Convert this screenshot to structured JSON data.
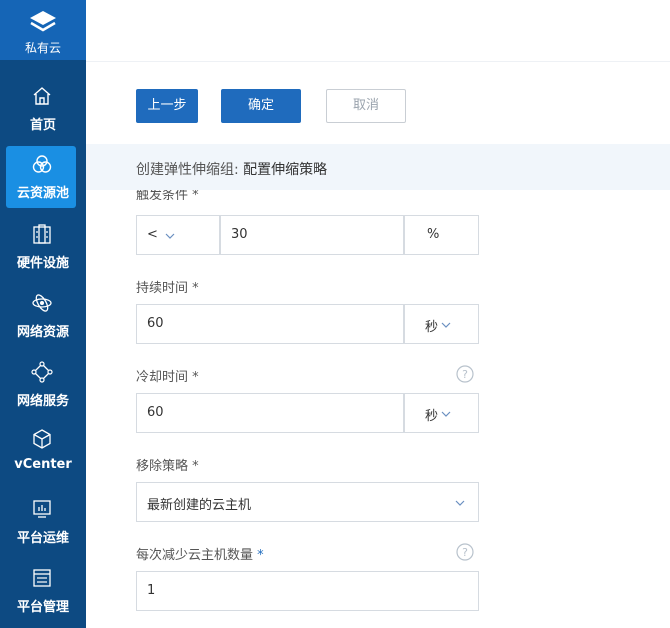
{
  "brand": {
    "label": "私有云",
    "icon": "layers-icon"
  },
  "nav": {
    "items": [
      {
        "label": "首页",
        "icon": "home-icon"
      },
      {
        "label": "云资源池",
        "icon": "cloud-pool-icon",
        "active": true
      },
      {
        "label": "硬件设施",
        "icon": "server-icon"
      },
      {
        "label": "网络资源",
        "icon": "network-icon"
      },
      {
        "label": "网络服务",
        "icon": "network-service-icon"
      },
      {
        "label": "vCenter",
        "icon": "cube-icon"
      },
      {
        "label": "平台运维",
        "icon": "monitor-icon"
      },
      {
        "label": "平台管理",
        "icon": "window-icon"
      }
    ]
  },
  "toolbar": {
    "prev_label": "上一步",
    "ok_label": "确定",
    "cancel_label": "取消"
  },
  "section": {
    "prefix": "创建弹性伸缩组:",
    "title": "配置伸缩策略"
  },
  "form": {
    "trigger": {
      "label": "触发条件",
      "required_mark": "*",
      "operator": "<",
      "value": "30",
      "unit": "%"
    },
    "duration": {
      "label": "持续时间",
      "required_mark": "*",
      "value": "60",
      "unit": "秒"
    },
    "cooldown": {
      "label": "冷却时间",
      "required_mark": "*",
      "value": "60",
      "unit": "秒"
    },
    "removal_policy": {
      "label": "移除策略",
      "required_mark": "*",
      "value": "最新创建的云主机"
    },
    "decrease_count": {
      "label": "每次减少云主机数量",
      "required_mark": "*",
      "value": "1"
    }
  },
  "colors": {
    "sidebar": "#0d4a82",
    "brand": "#1565b6",
    "active_nav": "#1a8fe3",
    "primary_button": "#1f6bbd",
    "section_bar": "#f1f6fb"
  }
}
